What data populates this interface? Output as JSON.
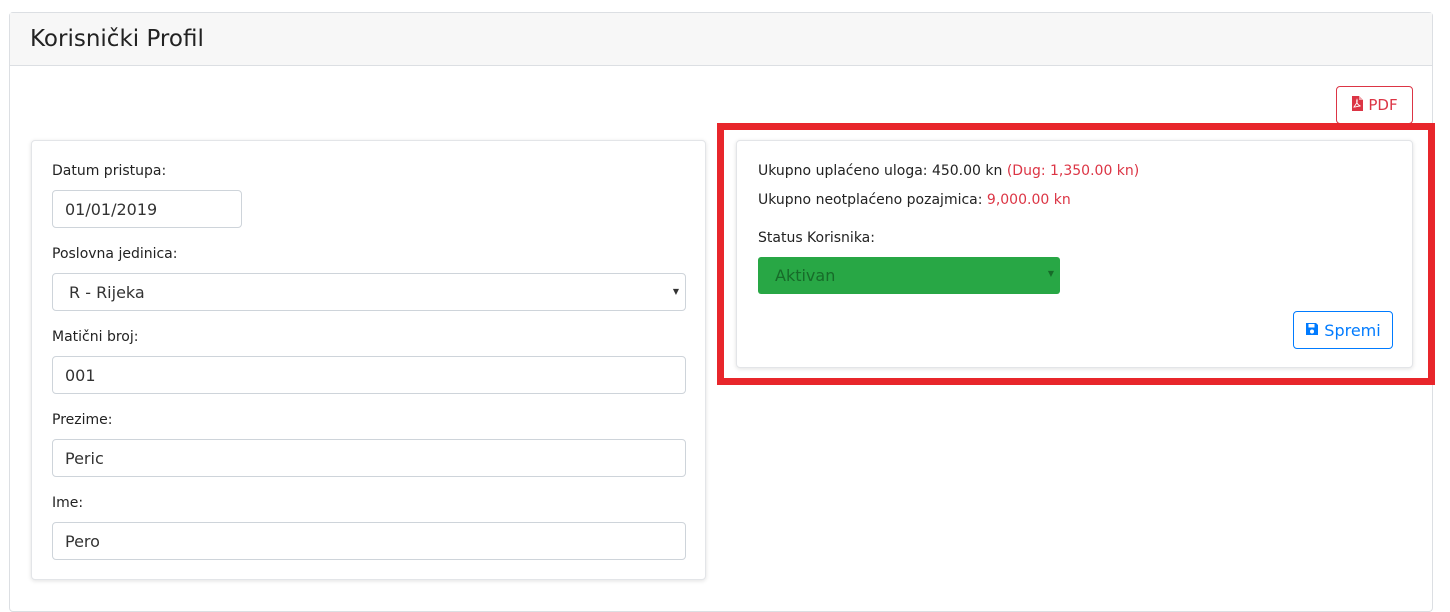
{
  "page_title": "Korisnički Profil",
  "toolbar": {
    "pdf_label": "PDF",
    "pdf_icon": "file-pdf-icon"
  },
  "form": {
    "date_label": "Datum pristupa:",
    "date_value": "01/01/2019",
    "unit_label": "Poslovna jedinica:",
    "unit_value": "R - Rijeka",
    "reg_label": "Matični broj:",
    "reg_value": "001",
    "surname_label": "Prezime:",
    "surname_value": "Peric",
    "name_label": "Ime:",
    "name_value": "Pero"
  },
  "summary": {
    "paid_label": "Ukupno uplaćeno uloga: 450.00 kn",
    "debt_text": "(Dug: 1,350.00 kn)",
    "unpaid_label": "Ukupno neotplaćeno pozajmica:",
    "unpaid_value": "9,000.00 kn",
    "status_label": "Status Korisnika:",
    "status_value": "Aktivan",
    "save_label": "Spremi",
    "save_icon": "save-icon"
  },
  "colors": {
    "highlight": "#e8262b",
    "danger": "#dc3545",
    "primary": "#007bff",
    "success": "#28a745"
  }
}
